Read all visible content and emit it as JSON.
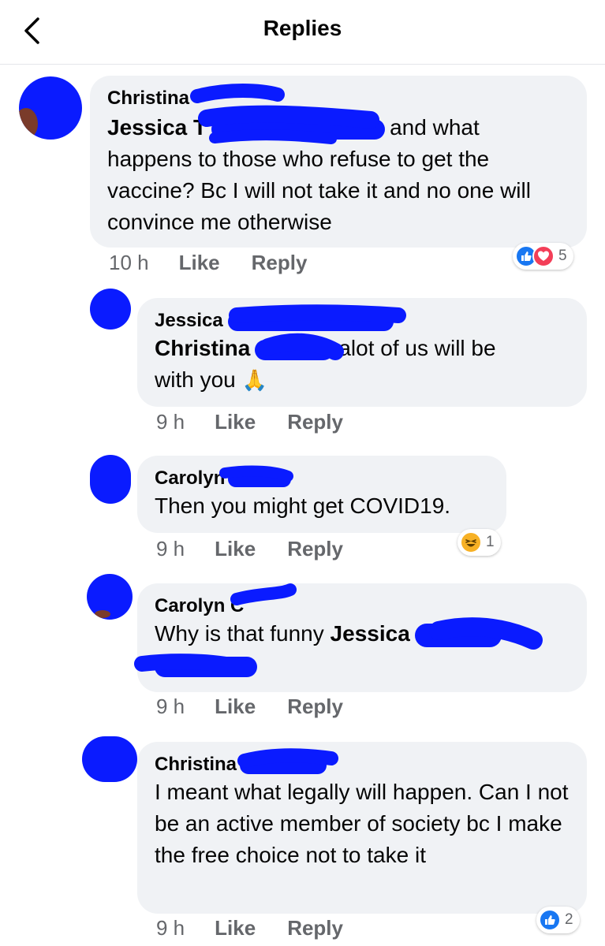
{
  "header": {
    "title": "Replies"
  },
  "colors": {
    "like_blue": "#1877f2",
    "love_red": "#f33e58",
    "haha_yellow": "#f7b125",
    "redaction": "#0a1bff"
  },
  "comments": [
    {
      "author": "Christina",
      "mention": "Jessica T",
      "text_line1_tail": "and what",
      "text_rest": "happens to those who refuse to get the vaccine? Bc I will not take it and no one will convince me otherwise",
      "time": "10 h",
      "like": "Like",
      "reply": "Reply",
      "reaction_count": "5"
    },
    {
      "author": "Jessica",
      "mention": "Christina",
      "text_tail": "alot of us will be",
      "text_line2": "with you",
      "emoji": "🙏",
      "time": "9 h",
      "like": "Like",
      "reply": "Reply"
    },
    {
      "author": "Carolyn",
      "text": "Then you might get COVID19.",
      "time": "9 h",
      "like": "Like",
      "reply": "Reply",
      "reaction_count": "1"
    },
    {
      "author": "Carolyn C",
      "text": "Why is that funny",
      "mention": "Jessica",
      "time": "9 h",
      "like": "Like",
      "reply": "Reply"
    },
    {
      "author": "Christina",
      "text": "I meant what legally will happen. Can I not be an active member of society bc I make the free choice not to take it",
      "time": "9 h",
      "like": "Like",
      "reply": "Reply",
      "reaction_count": "2"
    }
  ]
}
